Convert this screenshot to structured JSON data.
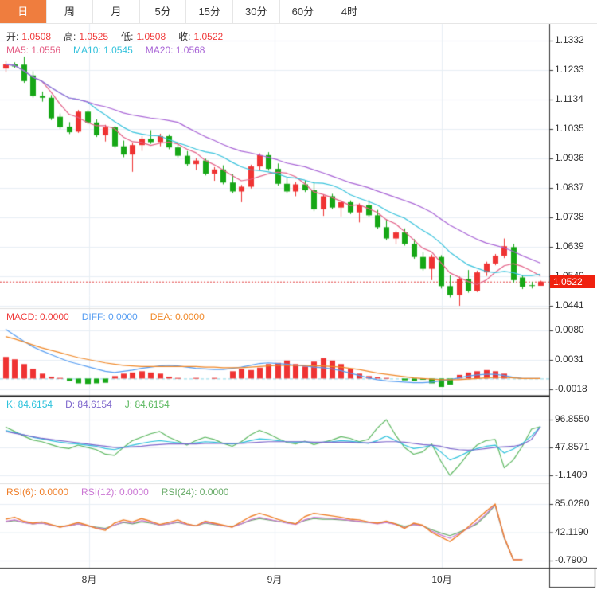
{
  "tabs": {
    "items": [
      "日",
      "周",
      "月",
      "5分",
      "15分",
      "30分",
      "60分",
      "4时"
    ],
    "active_index": 0
  },
  "legend": {
    "ohlc": {
      "open_label": "开:",
      "open": "1.0508",
      "high_label": "高:",
      "high": "1.0525",
      "low_label": "低:",
      "low": "1.0508",
      "close_label": "收:",
      "close": "1.0522"
    },
    "ma": {
      "ma5": "MA5: 1.0556",
      "ma10": "MA10: 1.0545",
      "ma20": "MA20: 1.0568"
    },
    "macd": {
      "macd": "MACD: 0.0000",
      "diff": "DIFF: 0.0000",
      "dea": "DEA: 0.0000"
    },
    "kdj": {
      "k": "K: 84.6154",
      "d": "D: 84.6154",
      "j": "J: 84.6154"
    },
    "rsi": {
      "rsi6": "RSI(6): 0.0000",
      "rsi12": "RSI(12): 0.0000",
      "rsi24": "RSI(24): 0.0000"
    }
  },
  "current_price_badge": "1.0522",
  "colors": {
    "tab_active_bg": "#ef7d3e",
    "text": "#333333",
    "value_red": "#f03b3b",
    "up": "#ef3333",
    "down": "#16a716",
    "ma5": "#e45f86",
    "ma10": "#35c2dc",
    "ma20": "#a863d6",
    "macd_label": "#f03b3b",
    "diff": "#569df2",
    "dea": "#f08828",
    "k": "#2cc2dc",
    "d": "#7d66cc",
    "j": "#5cb860",
    "rsi6": "#ef7f2a",
    "rsi12": "#cb77d4",
    "rsi24": "#67aa67",
    "grid": "#e7eef5",
    "axis": "#333333",
    "divider_light": "#e0e0e0",
    "divider_dark": "#1a1a1a",
    "zero_dash": "#8fd8e8",
    "price_line": "#e23b3b",
    "badge_bg": "#f0210f"
  },
  "chart_data": [
    {
      "type": "candlestick",
      "panel": "main",
      "title": "EUR daily candles with MA5/MA10/MA20",
      "yticks": [
        "1.1332",
        "1.1233",
        "1.1134",
        "1.1035",
        "1.0936",
        "1.0837",
        "1.0738",
        "1.0639",
        "1.0540",
        "1.0441"
      ],
      "xticks": [
        "8月",
        "9月",
        "10月"
      ],
      "current_price": 1.0522,
      "ma_periods": [
        5,
        10,
        20
      ],
      "ohlc": [
        [
          1.1238,
          1.1265,
          1.1225,
          1.1252
        ],
        [
          1.1252,
          1.1259,
          1.1241,
          1.1245
        ],
        [
          1.1251,
          1.1278,
          1.119,
          1.1196
        ],
        [
          1.1215,
          1.1229,
          1.114,
          1.1146
        ],
        [
          1.1146,
          1.1161,
          1.1127,
          1.114
        ],
        [
          1.114,
          1.1149,
          1.1065,
          1.1071
        ],
        [
          1.1076,
          1.1087,
          1.1035,
          1.1041
        ],
        [
          1.1043,
          1.1058,
          1.1018,
          1.1024
        ],
        [
          1.1026,
          1.1099,
          1.1022,
          1.1093
        ],
        [
          1.1093,
          1.1099,
          1.1051,
          1.1057
        ],
        [
          1.1057,
          1.1067,
          1.1008,
          1.1014
        ],
        [
          1.1014,
          1.1049,
          1.0993,
          1.1041
        ],
        [
          1.1041,
          1.1045,
          1.0971,
          1.0977
        ],
        [
          1.0977,
          1.0996,
          1.094,
          1.0949
        ],
        [
          1.0949,
          1.0989,
          1.0891,
          1.0981
        ],
        [
          1.0981,
          1.1011,
          1.0961,
          1.1002
        ],
        [
          1.1002,
          1.1031,
          1.0985,
          1.0991
        ],
        [
          1.0991,
          1.1019,
          1.0977,
          1.1011
        ],
        [
          1.1011,
          1.1017,
          1.0967,
          1.0973
        ],
        [
          1.0973,
          1.0991,
          1.0939,
          1.0945
        ],
        [
          1.0945,
          1.0961,
          1.0911,
          1.0917
        ],
        [
          1.0917,
          1.0937,
          1.0897,
          1.0929
        ],
        [
          1.0929,
          1.0935,
          1.0879,
          1.0885
        ],
        [
          1.0885,
          1.0907,
          1.0861,
          1.0899
        ],
        [
          1.0899,
          1.0913,
          1.0849,
          1.0855
        ],
        [
          1.0855,
          1.0883,
          1.0819,
          1.0825
        ],
        [
          1.0825,
          1.0847,
          1.0789,
          1.0841
        ],
        [
          1.0841,
          1.0915,
          1.0835,
          1.0909
        ],
        [
          1.0909,
          1.0953,
          1.0895,
          1.0947
        ],
        [
          1.0947,
          1.0957,
          1.0895,
          1.0901
        ],
        [
          1.0901,
          1.0919,
          1.0845,
          1.0851
        ],
        [
          1.0851,
          1.0871,
          1.0819,
          1.0825
        ],
        [
          1.0825,
          1.0857,
          1.0809,
          1.0849
        ],
        [
          1.0849,
          1.0863,
          1.0823,
          1.0829
        ],
        [
          1.0829,
          1.0857,
          1.0759,
          1.0765
        ],
        [
          1.0765,
          1.0815,
          1.0743,
          1.0809
        ],
        [
          1.0809,
          1.0817,
          1.0765,
          1.0771
        ],
        [
          1.0771,
          1.0797,
          1.0741,
          1.0789
        ],
        [
          1.0789,
          1.0795,
          1.0749,
          1.0755
        ],
        [
          1.0755,
          1.0785,
          1.0721,
          1.0779
        ],
        [
          1.0779,
          1.0797,
          1.0739,
          1.0745
        ],
        [
          1.0745,
          1.0763,
          1.0699,
          1.0705
        ],
        [
          1.0705,
          1.0731,
          1.0661,
          1.0667
        ],
        [
          1.0667,
          1.0693,
          1.0647,
          1.0687
        ],
        [
          1.0687,
          1.0701,
          1.0643,
          1.0649
        ],
        [
          1.0649,
          1.0665,
          1.0599,
          1.0605
        ],
        [
          1.0605,
          1.0621,
          1.0559,
          1.0565
        ],
        [
          1.0565,
          1.0613,
          1.0527,
          1.0605
        ],
        [
          1.0605,
          1.0611,
          1.0499,
          1.0507
        ],
        [
          1.0507,
          1.0543,
          1.0469,
          1.0477
        ],
        [
          1.0477,
          1.0539,
          1.0441,
          1.0531
        ],
        [
          1.0531,
          1.0561,
          1.0485,
          1.0491
        ],
        [
          1.0491,
          1.0559,
          1.0487,
          1.0553
        ],
        [
          1.0553,
          1.0589,
          1.0541,
          1.0583
        ],
        [
          1.0583,
          1.0615,
          1.0577,
          1.0609
        ],
        [
          1.0609,
          1.0667,
          1.0601,
          1.0641
        ],
        [
          1.0638,
          1.0649,
          1.0519,
          1.0527
        ],
        [
          1.0536,
          1.0543,
          1.0497,
          1.0505
        ],
        [
          1.051,
          1.0521,
          1.0499,
          1.0508
        ],
        [
          1.0508,
          1.0525,
          1.0508,
          1.0522
        ]
      ]
    },
    {
      "type": "bar",
      "panel": "macd",
      "title": "MACD",
      "yticks": [
        "0.0080",
        "0.0031",
        "-0.0018"
      ],
      "histogram": [
        0.0036,
        0.0032,
        0.0024,
        0.0016,
        0.0008,
        0.0003,
        0.0001,
        -0.0004,
        -0.0008,
        -0.0009,
        -0.0008,
        -0.0007,
        0.0004,
        0.0008,
        0.001,
        0.0012,
        0.001,
        0.0008,
        0.0003,
        0.0001,
        0.0,
        0.0001,
        0.0,
        0.0001,
        0.0,
        0.0012,
        0.0016,
        0.0014,
        0.0018,
        0.0024,
        0.0026,
        0.003,
        0.0024,
        0.002,
        0.0028,
        0.0034,
        0.003,
        0.0024,
        0.0016,
        0.0008,
        0.0004,
        0.0002,
        0.0001,
        0.0,
        -0.0003,
        -0.0004,
        -0.0002,
        -0.0008,
        -0.0014,
        -0.001,
        0.0006,
        0.001,
        0.0012,
        0.0014,
        0.0012,
        0.0008,
        0.0,
        0.0,
        0.0,
        0.0
      ],
      "diff": [
        0.0082,
        0.0072,
        0.0062,
        0.0053,
        0.0046,
        0.004,
        0.0034,
        0.0028,
        0.0024,
        0.002,
        0.0016,
        0.0012,
        0.001,
        0.0012,
        0.0014,
        0.0017,
        0.0019,
        0.0021,
        0.0022,
        0.0021,
        0.0019,
        0.0017,
        0.0016,
        0.0015,
        0.0015,
        0.0017,
        0.0019,
        0.0022,
        0.0025,
        0.0026,
        0.0025,
        0.0024,
        0.0022,
        0.0021,
        0.0019,
        0.0018,
        0.0016,
        0.0013,
        0.0009,
        0.0005,
        0.0001,
        -0.0002,
        -0.0004,
        -0.0005,
        -0.0006,
        -0.0007,
        -0.0007,
        -0.0006,
        -0.0004,
        -0.0002,
        0.0001,
        0.0004,
        0.0006,
        0.0007,
        0.0007,
        0.0005,
        0.0002,
        0.0,
        0.0,
        0.0
      ],
      "dea": [
        0.007,
        0.0066,
        0.0061,
        0.0056,
        0.0051,
        0.0047,
        0.0043,
        0.0039,
        0.0035,
        0.0032,
        0.0029,
        0.0026,
        0.0024,
        0.0022,
        0.0021,
        0.002,
        0.002,
        0.002,
        0.002,
        0.002,
        0.002,
        0.002,
        0.0019,
        0.0019,
        0.0018,
        0.0018,
        0.0018,
        0.0019,
        0.002,
        0.0021,
        0.0022,
        0.0022,
        0.0022,
        0.0022,
        0.0021,
        0.0021,
        0.002,
        0.0019,
        0.0017,
        0.0015,
        0.0012,
        0.0009,
        0.0007,
        0.0005,
        0.0003,
        0.0001,
        0.0,
        -0.0001,
        -0.0002,
        -0.0002,
        -0.0002,
        -0.0001,
        0.0,
        0.0001,
        0.0002,
        0.0002,
        0.0001,
        0.0,
        0.0,
        0.0
      ]
    },
    {
      "type": "line",
      "panel": "kdj",
      "title": "KDJ",
      "yticks": [
        "96.8550",
        "47.8571",
        "-1.1409"
      ],
      "k": [
        78,
        74,
        70,
        66,
        63,
        60,
        57,
        55,
        54,
        52,
        50,
        46,
        44,
        48,
        52,
        55,
        58,
        60,
        58,
        56,
        54,
        56,
        58,
        57,
        55,
        54,
        56,
        60,
        63,
        62,
        60,
        58,
        57,
        58,
        56,
        57,
        58,
        60,
        59,
        57,
        55,
        60,
        68,
        60,
        52,
        46,
        48,
        52,
        40,
        26,
        32,
        40,
        46,
        50,
        52,
        38,
        45,
        55,
        68,
        84.6154
      ],
      "d": [
        76,
        73,
        70,
        67,
        64,
        62,
        60,
        58,
        56,
        54,
        52,
        50,
        48,
        48,
        49,
        50,
        52,
        53,
        54,
        54,
        54,
        54,
        55,
        55,
        55,
        55,
        55,
        56,
        57,
        58,
        58,
        58,
        58,
        58,
        57,
        57,
        57,
        57,
        57,
        56,
        56,
        57,
        58,
        58,
        57,
        55,
        53,
        52,
        50,
        46,
        44,
        43,
        44,
        46,
        48,
        49,
        50,
        53,
        62,
        84.6154
      ],
      "j": [
        84,
        76,
        68,
        61,
        58,
        53,
        48,
        46,
        52,
        48,
        44,
        36,
        34,
        48,
        60,
        66,
        72,
        76,
        66,
        59,
        52,
        60,
        66,
        62,
        55,
        50,
        58,
        70,
        78,
        72,
        64,
        57,
        54,
        59,
        53,
        57,
        61,
        67,
        64,
        58,
        62,
        82,
        96.8,
        70,
        48,
        36,
        40,
        54,
        24,
        -1.1409,
        16,
        36,
        52,
        60,
        62,
        12,
        26,
        50,
        80,
        84.6154
      ]
    },
    {
      "type": "line",
      "panel": "rsi",
      "title": "RSI",
      "yticks": [
        "85.0280",
        "42.1190",
        "-0.7900"
      ],
      "rsi6": [
        62,
        65,
        59,
        56,
        58,
        54,
        50,
        53,
        57,
        53,
        48,
        45,
        56,
        61,
        58,
        63,
        59,
        54,
        57,
        61,
        55,
        52,
        59,
        56,
        53,
        50,
        58,
        66,
        71,
        67,
        62,
        58,
        55,
        66,
        71,
        69,
        67,
        65,
        62,
        61,
        58,
        56,
        59,
        55,
        48,
        56,
        53,
        42,
        35,
        28,
        38,
        50,
        62,
        74,
        85.028,
        35,
        0.5,
        0.5,
        null,
        null
      ],
      "rsi12": [
        59,
        61,
        57,
        55,
        56,
        53,
        50,
        52,
        55,
        52,
        49,
        47,
        53,
        58,
        56,
        60,
        57,
        53,
        55,
        58,
        54,
        52,
        57,
        55,
        52,
        50,
        55,
        61,
        65,
        62,
        59,
        56,
        54,
        61,
        65,
        64,
        63,
        62,
        60,
        59,
        57,
        55,
        57,
        54,
        49,
        54,
        52,
        44,
        38,
        33,
        40,
        48,
        57,
        70,
        84,
        34,
        0.8,
        0.8,
        null,
        null
      ],
      "rsi24": [
        58,
        60,
        57,
        55,
        56,
        53,
        51,
        52,
        55,
        52,
        50,
        48,
        53,
        57,
        55,
        58,
        56,
        53,
        55,
        57,
        54,
        52,
        56,
        54,
        52,
        51,
        55,
        60,
        63,
        61,
        59,
        57,
        55,
        60,
        63,
        62,
        62,
        61,
        60,
        58,
        57,
        56,
        57,
        55,
        51,
        54,
        52,
        46,
        41,
        37,
        42,
        48,
        55,
        68,
        83,
        33,
        1,
        1,
        null,
        null
      ]
    }
  ]
}
